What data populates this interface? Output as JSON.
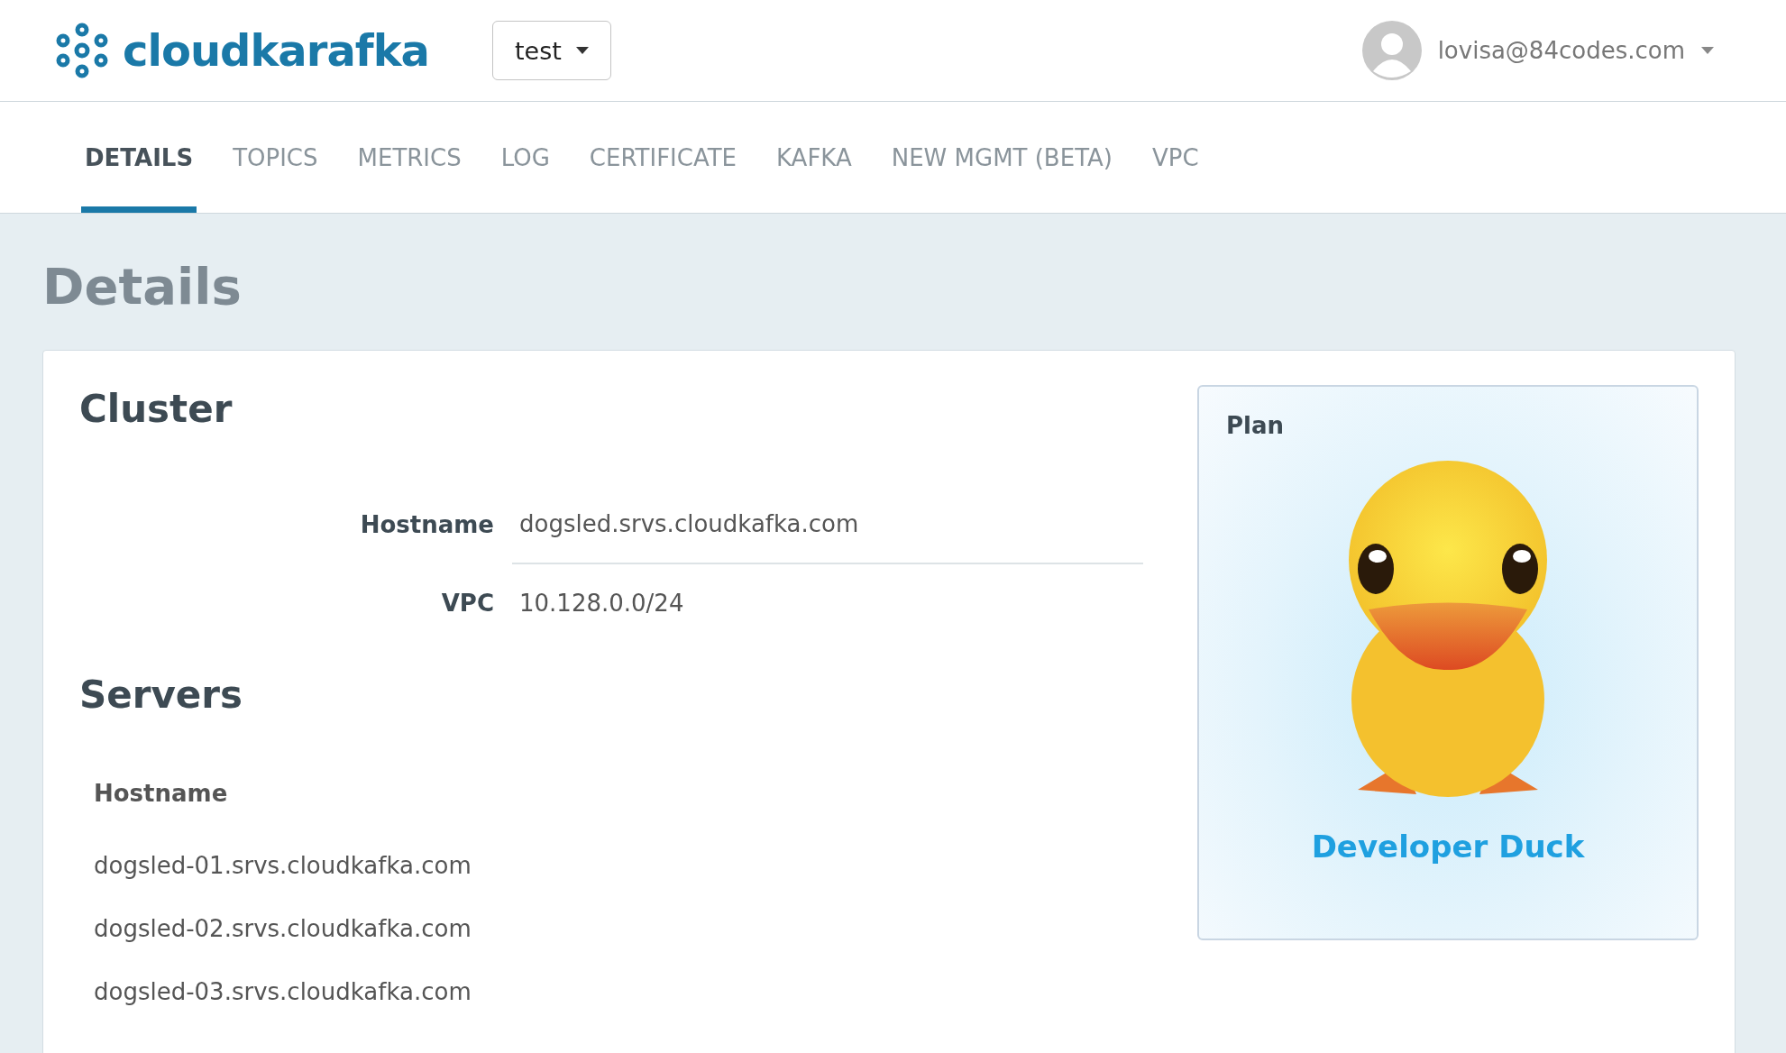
{
  "header": {
    "logo": "cloudkarafka",
    "instance_select": {
      "value": "test"
    },
    "user": {
      "email": "lovisa@84codes.com"
    }
  },
  "tabs": [
    {
      "label": "DETAILS",
      "selected": true
    },
    {
      "label": "TOPICS",
      "selected": false
    },
    {
      "label": "METRICS",
      "selected": false
    },
    {
      "label": "LOG",
      "selected": false
    },
    {
      "label": "CERTIFICATE",
      "selected": false
    },
    {
      "label": "KAFKA",
      "selected": false
    },
    {
      "label": "NEW MGMT (BETA)",
      "selected": false
    },
    {
      "label": "VPC",
      "selected": false
    }
  ],
  "page_title": "Details",
  "cluster": {
    "title": "Cluster",
    "fields": [
      {
        "label": "Hostname",
        "value": "dogsled.srvs.cloudkafka.com"
      },
      {
        "label": "VPC",
        "value": "10.128.0.0/24"
      }
    ]
  },
  "servers": {
    "title": "Servers",
    "column": "Hostname",
    "rows": [
      "dogsled-01.srvs.cloudkafka.com",
      "dogsled-02.srvs.cloudkafka.com",
      "dogsled-03.srvs.cloudkafka.com"
    ]
  },
  "plan": {
    "title": "Plan",
    "name": "Developer Duck"
  }
}
